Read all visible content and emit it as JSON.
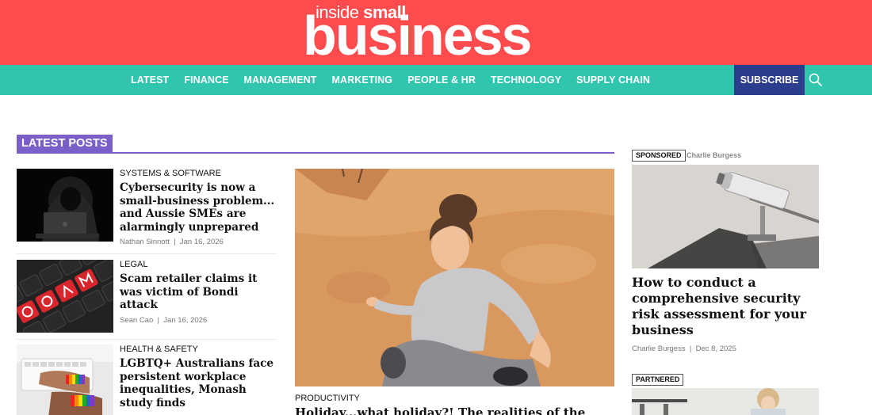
{
  "brand": {
    "logo_small_prefix": "inside ",
    "logo_small_bold": "small",
    "logo_big": "business",
    "header_color": "#fe4b4d",
    "nav_color": "#30c5ad",
    "subscribe_color": "#2c3d8e",
    "accent_purple": "#7b5fc9"
  },
  "nav": {
    "items": [
      {
        "label": "LATEST"
      },
      {
        "label": "FINANCE"
      },
      {
        "label": "MANAGEMENT"
      },
      {
        "label": "MARKETING"
      },
      {
        "label": "PEOPLE & HR"
      },
      {
        "label": "TECHNOLOGY"
      },
      {
        "label": "SUPPLY CHAIN"
      }
    ],
    "subscribe_label": "SUBSCRIBE",
    "search_icon": "search-icon"
  },
  "latest": {
    "heading": "LATEST POSTS",
    "posts": [
      {
        "category": "SYSTEMS & SOFTWARE",
        "title": "Cybersecurity is now a small-business problem... and Aussie SMEs are alarmingly unprepared",
        "author": "Nathan Sinnott",
        "date": "Jan 16, 2026"
      },
      {
        "category": "LEGAL",
        "title": "Scam retailer claims it was victim of Bondi attack",
        "author": "Sean Cao",
        "date": "Jan 16, 2026"
      },
      {
        "category": "HEALTH & SAFETY",
        "title": "LGBTQ+ Australians face persistent workplace inequalities, Monash study finds",
        "author": "",
        "date": ""
      }
    ],
    "featured": {
      "category": "PRODUCTIVITY",
      "title": "Holiday...what holiday?! The realities of the"
    }
  },
  "sidebar": {
    "sponsored": {
      "badge": "SPONSORED",
      "author_top": "Charlie Burgess",
      "title": "How to conduct a comprehensive security risk assessment for your business",
      "author": "Charlie Burgess",
      "date": "Dec 8, 2025"
    },
    "partnered": {
      "badge": "PARTNERED"
    }
  },
  "meta_separator": "|"
}
